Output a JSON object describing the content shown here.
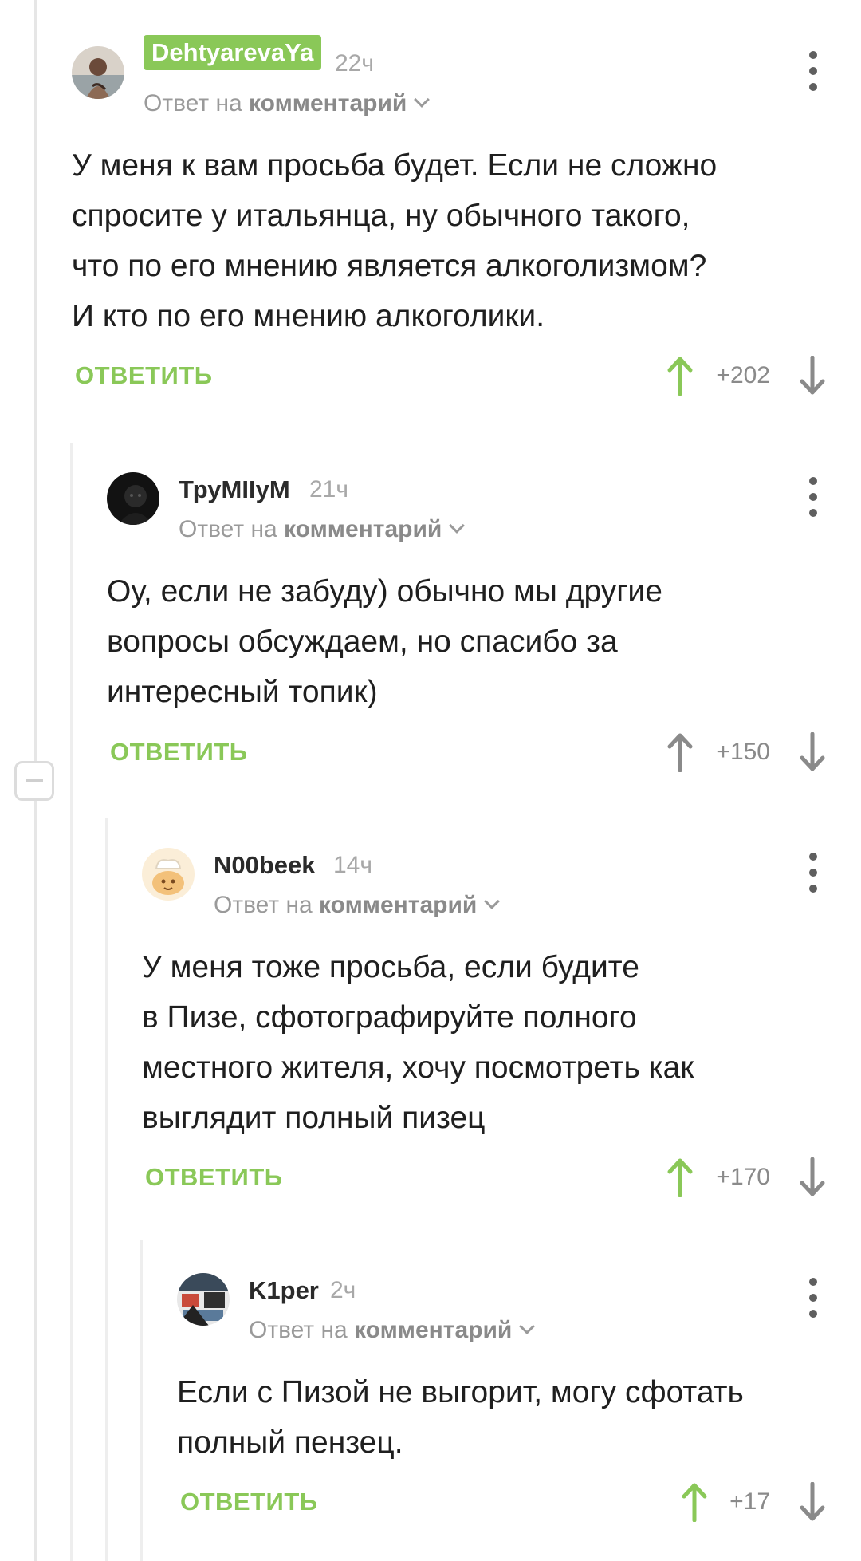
{
  "colors": {
    "accent_green": "#8ac858",
    "vote_up_active": "#8ac858",
    "vote_up_inactive": "#8a8a8a",
    "vote_down": "#8a8a8a"
  },
  "comments": [
    {
      "username": "DehtyarevaYa",
      "username_highlighted": true,
      "time": "22ч",
      "reply_prefix": "Ответ на",
      "reply_target": "комментарий",
      "text": "У меня к вам просьба будет. Если не сложно\nспросите у итальянца, ну обычного такого,\nчто по его мнению является алкоголизмом?\nИ кто по его мнению алкоголики.",
      "reply_label": "ОТВЕТИТЬ",
      "score": "+202",
      "upvoted": true,
      "avatar_icon": "user-photo-avatar-icon"
    },
    {
      "username": "ТруМIIуМ",
      "username_highlighted": false,
      "time": "21ч",
      "reply_prefix": "Ответ на",
      "reply_target": "комментарий",
      "text": "Оу, если не забуду) обычно мы другие\nвопросы обсуждаем, но спасибо за\nинтересный топик)",
      "reply_label": "ОТВЕТИТЬ",
      "score": "+150",
      "upvoted": false,
      "avatar_icon": "dark-portrait-avatar-icon"
    },
    {
      "username": "N00beek",
      "username_highlighted": false,
      "time": "14ч",
      "reply_prefix": "Ответ на",
      "reply_target": "комментарий",
      "text": "У меня тоже просьба, если будите\nв Пизе, сфотографируйте полного\nместного жителя, хочу посмотреть как\nвыглядит полный пизец",
      "reply_label": "ОТВЕТИТЬ",
      "score": "+170",
      "upvoted": true,
      "avatar_icon": "cartoon-chef-avatar-icon"
    },
    {
      "username": "K1per",
      "username_highlighted": false,
      "time": "2ч",
      "reply_prefix": "Ответ на",
      "reply_target": "комментарий",
      "text": "Если с Пизой не выгорит, могу сфотать\nполный пензец.",
      "reply_label": "ОТВЕТИТЬ",
      "score": "+17",
      "upvoted": true,
      "avatar_icon": "comic-avatar-icon"
    }
  ]
}
